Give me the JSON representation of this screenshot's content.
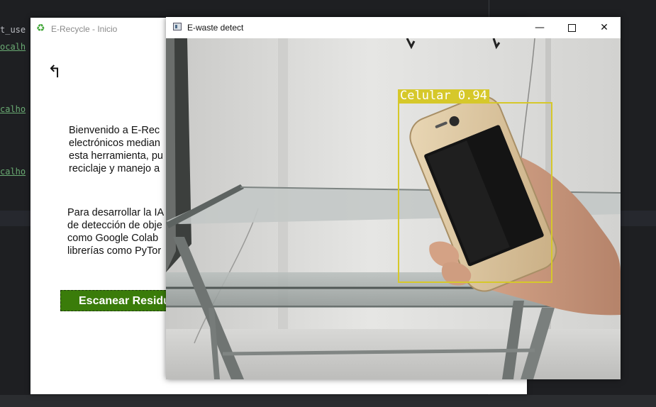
{
  "ide": {
    "lines": [
      "t_use",
      "ocalh",
      "calho",
      "calho"
    ]
  },
  "erecycle": {
    "title": "E-Recycle - Inicio",
    "title_icon": "recycle-icon",
    "back_icon": "back-arrow-icon",
    "paragraph1": [
      "Bienvenido a E-Rec",
      "electrónicos median",
      "esta herramienta, pu",
      "reciclaje y manejo a"
    ],
    "paragraph2": [
      "Para desarrollar la IA",
      "de detección de obje",
      "como Google Colab",
      "librerías como PyTor"
    ],
    "scan_button": "Escanear Residu"
  },
  "detect": {
    "title": "E-waste detect",
    "app_icon": "app-window-icon",
    "minimize_icon": "minimize-icon",
    "maximize_icon": "maximize-icon",
    "close_icon": "close-icon",
    "detection": {
      "label": "Celular 0.94",
      "color": "#d6c82a"
    }
  },
  "colors": {
    "ide_bg": "#1e1f22",
    "ide_link": "#6aab73",
    "button_green": "#3a7c0a"
  }
}
